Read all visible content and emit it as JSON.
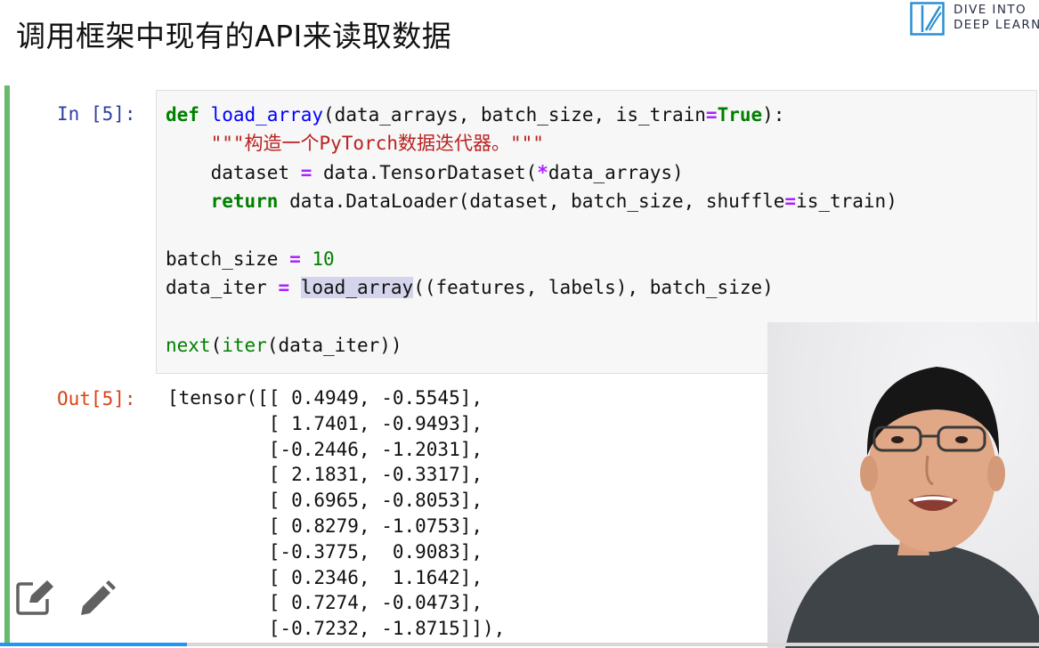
{
  "slide": {
    "title": "调用框架中现有的API来读取数据"
  },
  "logo": {
    "line1": "DIVE INTO",
    "line2": "DEEP LEARN",
    "accent": "#2b8fd1"
  },
  "cell": {
    "in_prompt": "In [5]:",
    "out_prompt": "Out[5]:",
    "code": {
      "l1_def": "def",
      "l1_fn": "load_array",
      "l1_a": "(data_arrays, batch_size, is_train",
      "l1_eq": "=",
      "l1_true": "True",
      "l1_end": "):",
      "l2_doc": "\"\"\"构造一个PyTorch数据迭代器。\"\"\"",
      "l3_a": "dataset ",
      "l3_eq": "=",
      "l3_b": " data.TensorDataset(",
      "l3_star": "*",
      "l3_c": "data_arrays)",
      "l4_ret": "return",
      "l4_a": " data.DataLoader(dataset, batch_size, shuffle",
      "l4_eq": "=",
      "l4_b": "is_train)",
      "l6_a": "batch_size ",
      "l6_eq": "=",
      "l6_num": "10",
      "l7_a": "data_iter ",
      "l7_eq": "=",
      "l7_hl": "load_array",
      "l7_b": "((features, labels), batch_size)",
      "l9_next": "next",
      "l9_a": "(",
      "l9_iter": "iter",
      "l9_b": "(data_iter))"
    },
    "output_lines": [
      "[tensor([[ 0.4949, -0.5545],",
      "         [ 1.7401, -0.9493],",
      "         [-0.2446, -1.2031],",
      "         [ 2.1831, -0.3317],",
      "         [ 0.6965, -0.8053],",
      "         [ 0.8279, -1.0753],",
      "         [-0.3775,  0.9083],",
      "         [ 0.2346,  1.1642],",
      "         [ 0.7274, -0.0473],",
      "         [-0.7232, -1.8715]]),"
    ]
  },
  "toolbar": {
    "edit_icon": "edit-square-icon",
    "pencil_icon": "pencil-icon"
  },
  "video": {
    "progress": 0.18,
    "progress_color": "#2196f3"
  }
}
